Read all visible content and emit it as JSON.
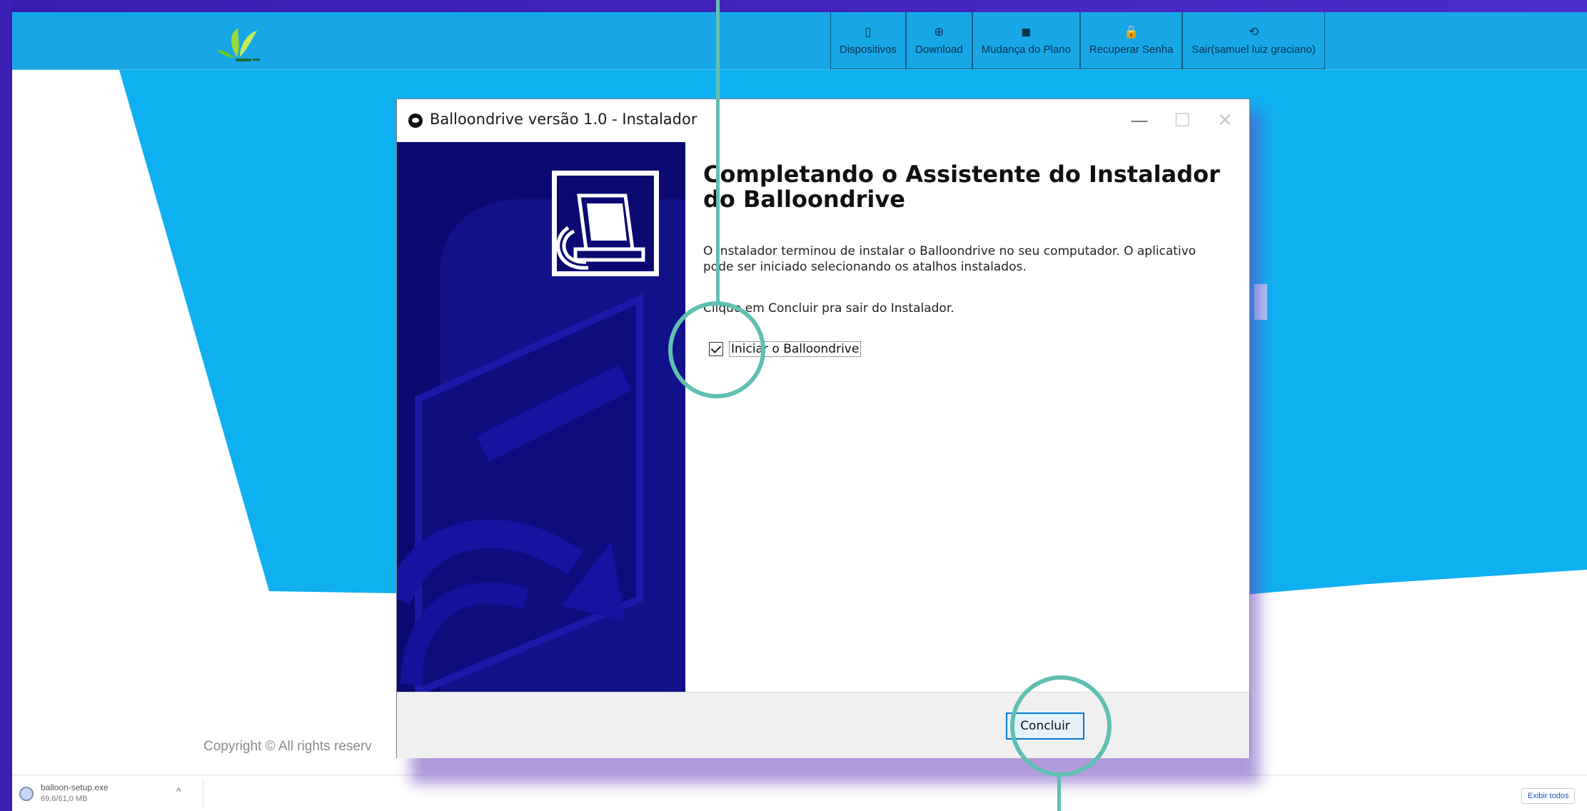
{
  "navbar": {
    "items": [
      {
        "icon": "phone-icon",
        "glyph": "▯",
        "label": "Dispositivos"
      },
      {
        "icon": "download-icon",
        "glyph": "⊕",
        "label": "Download"
      },
      {
        "icon": "bookmark-icon",
        "glyph": "◼",
        "label": "Mudança do Plano"
      },
      {
        "icon": "lock-icon",
        "glyph": "🔒",
        "label": "Recuperar Senha"
      },
      {
        "icon": "logout-icon",
        "glyph": "⟲",
        "label": "Sair(samuel luiz graciano)"
      }
    ]
  },
  "footer": {
    "copyright": "Copyright © All rights reserv"
  },
  "installer": {
    "title": "Balloondrive versão 1.0 - Instalador",
    "heading": "Completando o Assistente do Instalador do Balloondrive",
    "body": "O Instalador terminou de instalar o Balloondrive no seu computador. O aplicativo pode ser iniciado selecionando os atalhos instalados.",
    "instruction": "Clique em Concluir pra sair do Instalador.",
    "checkbox_label": "Iniciar o Balloondrive",
    "checkbox_checked": true,
    "finish_button": "Concluir",
    "window_buttons": {
      "minimize": "—",
      "maximize": "☐",
      "close": "✕"
    }
  },
  "downloads": {
    "file_name": "balloon-setup.exe",
    "file_size": "69,6/61,0 MB",
    "show_all": "Exibir todos"
  },
  "colors": {
    "frame": "#3b1fb5",
    "navbar": "#17a7e6",
    "hero_blue": "#0fb0f0",
    "installer_panel": "#0a0a72",
    "highlight": "#61bfb2",
    "button_border": "#0078d7"
  }
}
